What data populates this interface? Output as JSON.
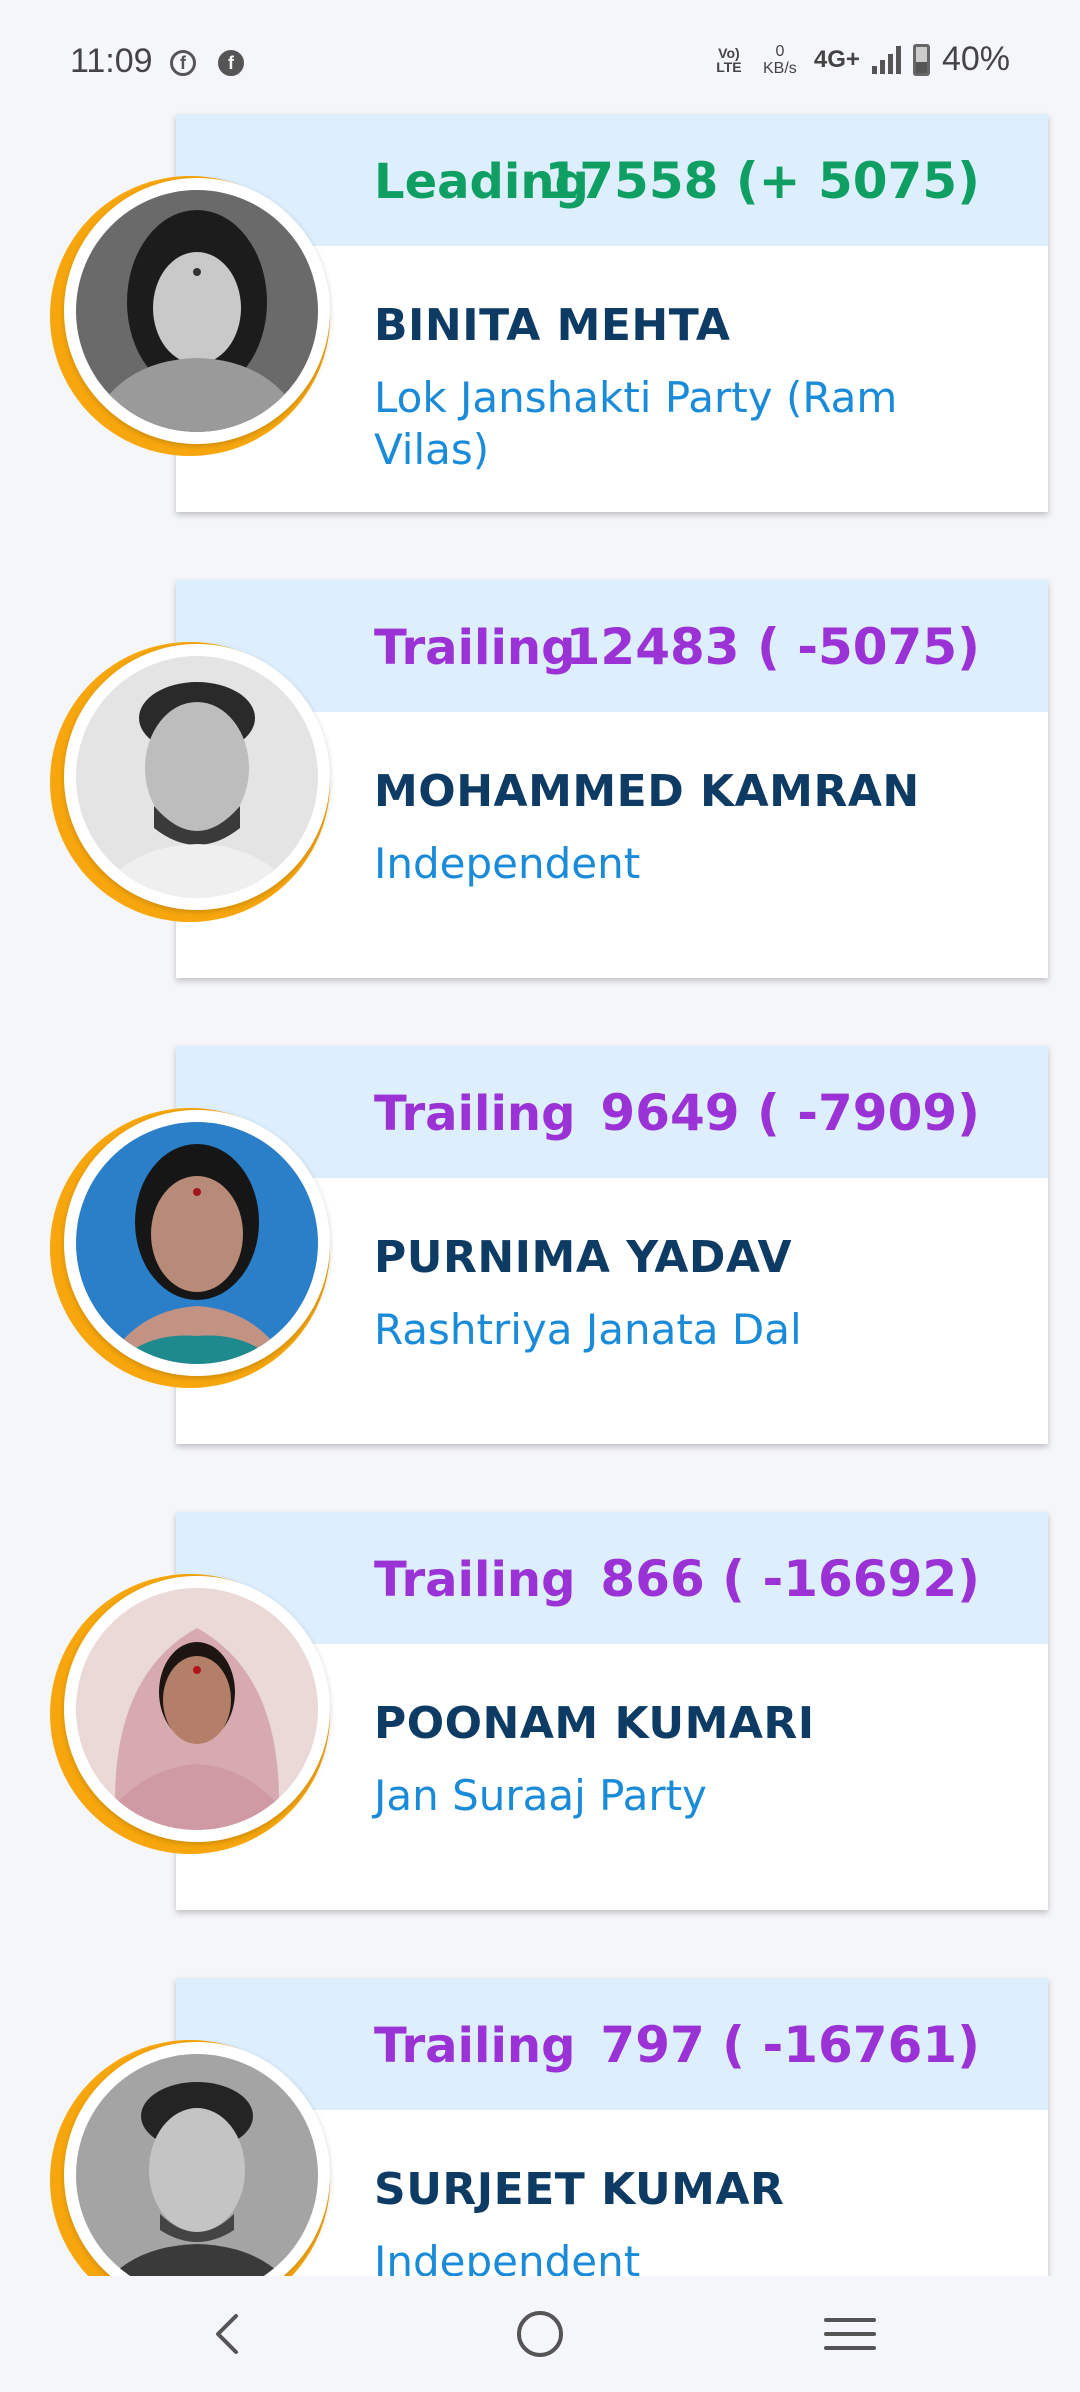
{
  "status_bar": {
    "time": "11:09",
    "network_badge": "Vo) LTE",
    "data_rate_value": "0",
    "data_rate_unit": "KB/s",
    "network_type": "4G+",
    "battery": "40%",
    "notification_icons": [
      "facebook-outline-icon",
      "facebook-icon"
    ]
  },
  "candidates": [
    {
      "status": "Leading",
      "votes": "17558 (+ 5075)",
      "name": "BINITA MEHTA",
      "party": "Lok Janshakti Party (Ram Vilas)",
      "status_type": "leading"
    },
    {
      "status": "Trailing",
      "votes": "12483 ( -5075)",
      "name": "MOHAMMED KAMRAN",
      "party": "Independent",
      "status_type": "trailing"
    },
    {
      "status": "Trailing",
      "votes": "9649 ( -7909)",
      "name": "PURNIMA YADAV",
      "party": "Rashtriya Janata Dal",
      "status_type": "trailing"
    },
    {
      "status": "Trailing",
      "votes": "866 ( -16692)",
      "name": "POONAM KUMARI",
      "party": "Jan Suraaj Party",
      "status_type": "trailing"
    },
    {
      "status": "Trailing",
      "votes": "797 ( -16761)",
      "name": "SURJEET KUMAR",
      "party": "Independent",
      "status_type": "trailing"
    }
  ],
  "colors": {
    "leading": "#0f9f63",
    "trailing": "#9b32d6",
    "name": "#0d3b63",
    "party": "#1a8bd8",
    "header_bg": "#ddeefc",
    "ring": "#f7a70d"
  },
  "nav": {
    "icons": [
      "back-icon",
      "home-icon",
      "recents-icon"
    ]
  }
}
